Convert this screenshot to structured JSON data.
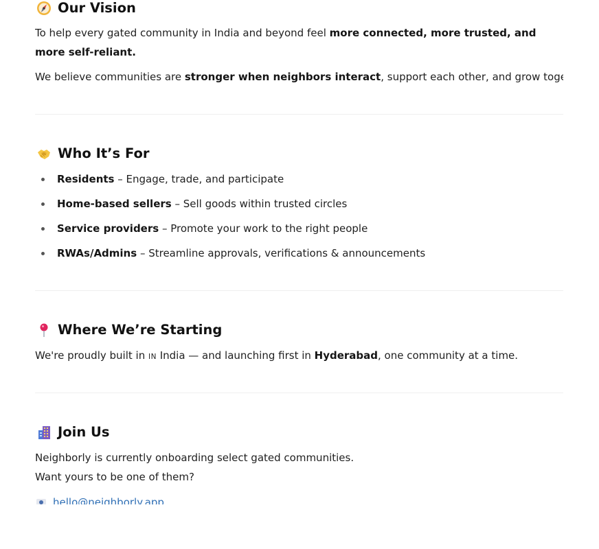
{
  "vision": {
    "icon": "compass-icon",
    "title": "Our Vision",
    "p1_pre": "To help every gated community in India and beyond feel ",
    "p1_bold": "more connected, more trusted, and more self-reliant.",
    "p2_pre": "We believe communities are ",
    "p2_bold": "stronger when neighbors interact",
    "p2_post": ", support each other, and grow together."
  },
  "audience": {
    "icon": "handshake-icon",
    "title": "Who It’s For",
    "items": [
      {
        "label": "Residents",
        "desc": " – Engage, trade, and participate"
      },
      {
        "label": "Home-based sellers",
        "desc": " – Sell goods within trusted circles"
      },
      {
        "label": "Service providers",
        "desc": " – Promote your work to the right people"
      },
      {
        "label": "RWAs/Admins",
        "desc": " – Streamline approvals, verifications & announcements"
      }
    ]
  },
  "starting": {
    "icon": "pushpin-icon",
    "title": "Where We’re Starting",
    "p_pre": "We're proudly built in ",
    "flag": "IN",
    "p_mid": " India — and launching first in ",
    "p_bold": "Hyderabad",
    "p_post": ", one community at a time."
  },
  "join": {
    "icon": "building-icon",
    "title": "Join Us",
    "line1": "Neighborly is currently onboarding select gated communities.",
    "line2": "Want yours to be one of them?",
    "email": "hello@neighborly.app"
  },
  "colors": {
    "text": "#1f1f1f",
    "heading": "#111111",
    "link": "#2f6fb5",
    "divider": "#efefef"
  }
}
